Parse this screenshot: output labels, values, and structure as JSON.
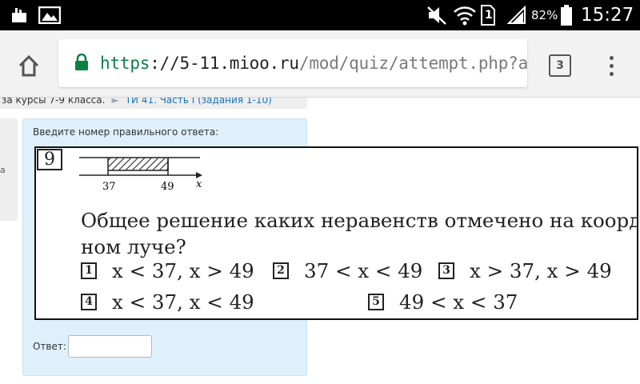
{
  "status_bar": {
    "battery_percent": "82%",
    "time": "15:27",
    "sim_slot": "1",
    "icons": [
      "notification-icon",
      "image-notification-icon",
      "mute-icon",
      "wifi-icon",
      "sim-icon",
      "signal-icon",
      "battery-icon"
    ]
  },
  "browser": {
    "url_scheme": "https",
    "url_host": "://5-11.mioo.ru",
    "url_path": "/mod/quiz/attempt.php?att",
    "tab_count": "3",
    "icons": [
      "home-icon",
      "lock-icon",
      "menu-icon"
    ],
    "secure_color": "#0b8043"
  },
  "page": {
    "breadcrumb": {
      "part1": "за курсы 7-9 класса.",
      "part2": "ТИ 41. Часть I (задания 1-10)"
    },
    "side_text": "а",
    "prompt": "Введите номер правильного ответа:",
    "answer_label": "Ответ:",
    "answer_value": ""
  },
  "problem": {
    "number": "9",
    "number_line": {
      "left": "37",
      "right": "49",
      "axis": "x"
    },
    "question_line1": "Общее решение каких неравенств отмечено на координат-",
    "question_line2": "ном луче?",
    "options": [
      {
        "id": "1",
        "text": "x < 37, x > 49"
      },
      {
        "id": "2",
        "text": "37 < x < 49"
      },
      {
        "id": "3",
        "text": "x > 37, x > 49"
      },
      {
        "id": "4",
        "text": "x < 37, x < 49"
      },
      {
        "id": "5",
        "text": "49 < x < 37"
      }
    ]
  }
}
